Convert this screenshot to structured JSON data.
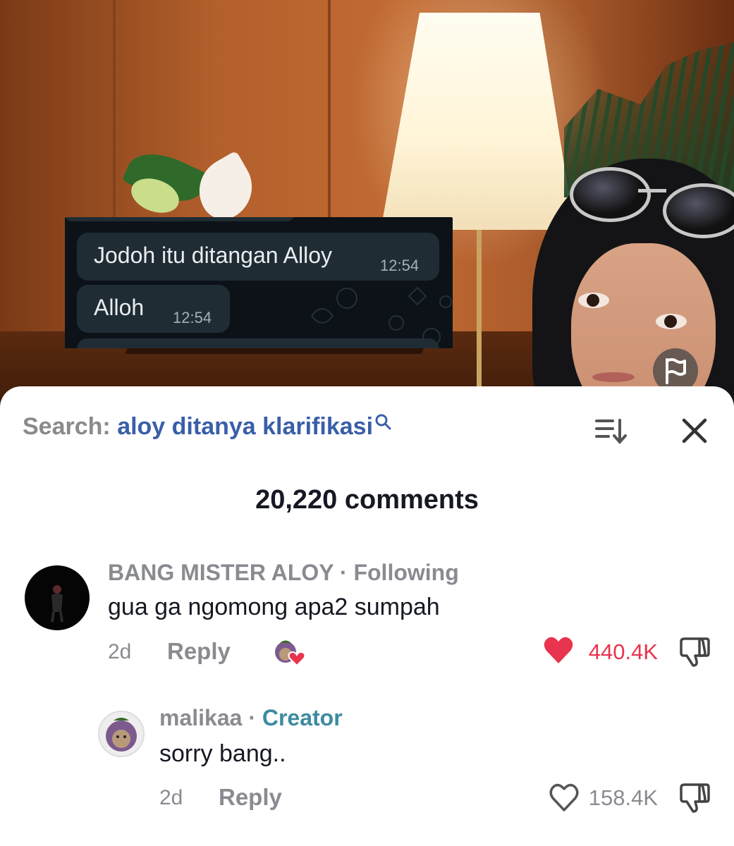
{
  "video": {
    "chat_overlay": {
      "messages": [
        {
          "text": "Jodoh itu ditangan Alloy",
          "time": "12:54"
        },
        {
          "text": "Alloh",
          "time": "12:54"
        }
      ]
    }
  },
  "search": {
    "label": "Search:",
    "query": "aloy ditanya klarifikasi"
  },
  "comments_header": {
    "count_text": "20,220 comments"
  },
  "comments": [
    {
      "username": "BANG MISTER ALOY",
      "separator": "·",
      "tag": "Following",
      "text": "gua ga ngomong apa2 sumpah",
      "date": "2d",
      "reply_label": "Reply",
      "likes": "440.4K",
      "liked": true
    },
    {
      "username": "malikaa",
      "separator": "·",
      "tag": "Creator",
      "text": "sorry bang..",
      "date": "2d",
      "reply_label": "Reply",
      "likes": "158.4K",
      "liked": false
    }
  ],
  "colors": {
    "like_red": "#e8344e",
    "search_query_blue": "#3a5fa8",
    "creator_teal": "#3d8ba0",
    "muted_gray": "#8a8b91"
  }
}
